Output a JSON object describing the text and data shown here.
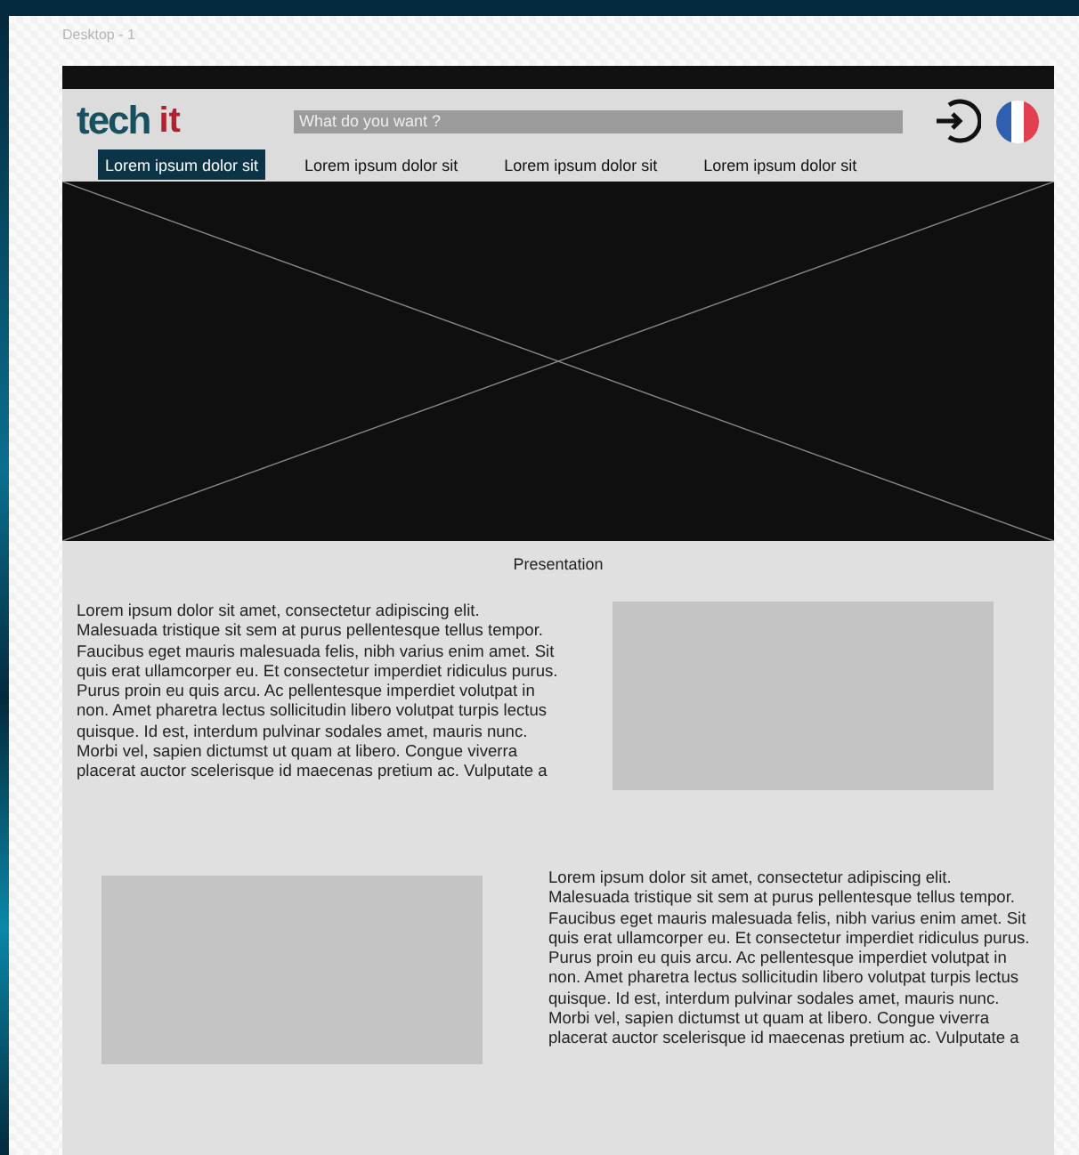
{
  "canvas": {
    "frame_label": "Desktop - 1"
  },
  "header": {
    "logo": {
      "part_1": "tech",
      "part_2": "it"
    },
    "search": {
      "placeholder": "What do you want ?"
    }
  },
  "nav": [
    {
      "label": "Lorem ipsum dolor sit",
      "selected": true
    },
    {
      "label": "Lorem ipsum dolor sit",
      "selected": false
    },
    {
      "label": "Lorem ipsum dolor sit",
      "selected": false
    },
    {
      "label": "Lorem ipsum dolor sit",
      "selected": false
    }
  ],
  "content": {
    "heading": "Presentation",
    "sections": [
      {
        "kind": "textfirst",
        "text": "Lorem ipsum dolor sit amet, consectetur adipiscing elit. Malesuada tristique sit sem at purus pellentesque tellus tempor. Faucibus eget mauris malesuada felis, nibh varius enim amet. Sit quis erat ullamcorper eu. Et consectetur imperdiet ridiculus purus. Purus proin eu quis arcu. Ac pellentesque imperdiet volutpat in non. Amet pharetra lectus sollicitudin libero volutpat turpis lectus quisque. Id est, interdum pulvinar sodales amet, mauris nunc. Morbi vel, sapien dictumst ut quam at libero. Congue viverra placerat auctor scelerisque id maecenas pretium ac. Vulputate a"
      },
      {
        "kind": "imagefirst",
        "text": "Lorem ipsum dolor sit amet, consectetur adipiscing elit. Malesuada tristique sit sem at purus pellentesque tellus tempor. Faucibus eget mauris malesuada felis, nibh varius enim amet. Sit quis erat ullamcorper eu. Et consectetur imperdiet ridiculus purus. Purus proin eu quis arcu. Ac pellentesque imperdiet volutpat in non. Amet pharetra lectus sollicitudin libero volutpat turpis lectus quisque. Id est, interdum pulvinar sodales amet, mauris nunc. Morbi vel, sapien dictumst ut quam at libero. Congue viverra placerat auctor scelerisque id maecenas pretium ac. Vulputate a"
      }
    ]
  }
}
